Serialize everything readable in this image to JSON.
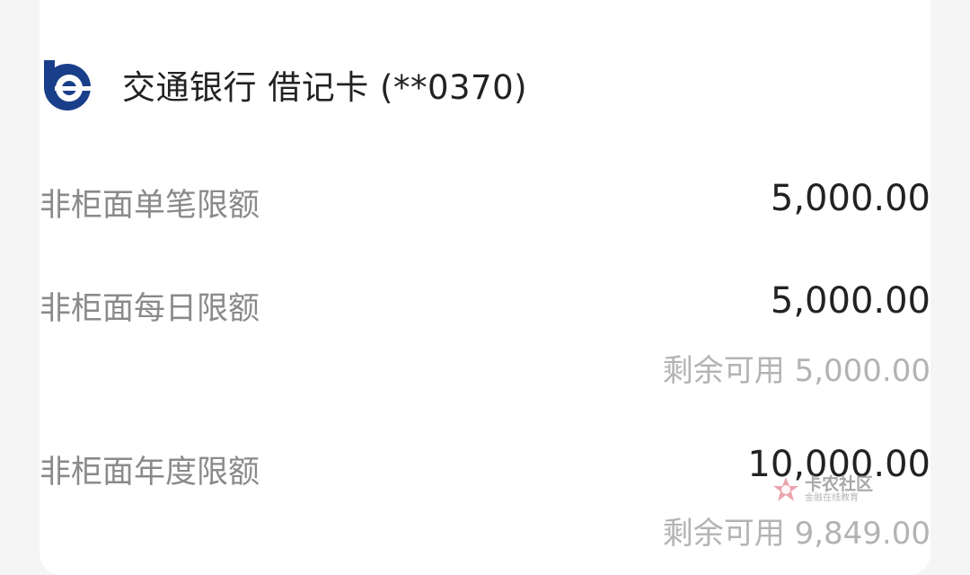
{
  "bank": {
    "logo_icon": "bank-of-communications-logo",
    "title": "交通银行 借记卡 (**0370)",
    "brand_color": "#1a3f8a"
  },
  "limits": [
    {
      "label": "非柜面单笔限额",
      "value": "5,000.00"
    },
    {
      "label": "非柜面每日限额",
      "value": "5,000.00",
      "remaining": "剩余可用 5,000.00"
    },
    {
      "label": "非柜面年度限额",
      "value": "10,000.00",
      "remaining": "剩余可用 9,849.00"
    }
  ],
  "watermark": {
    "icon": "kanong-logo",
    "main": "卡农社区",
    "sub": "金融在线教育"
  }
}
